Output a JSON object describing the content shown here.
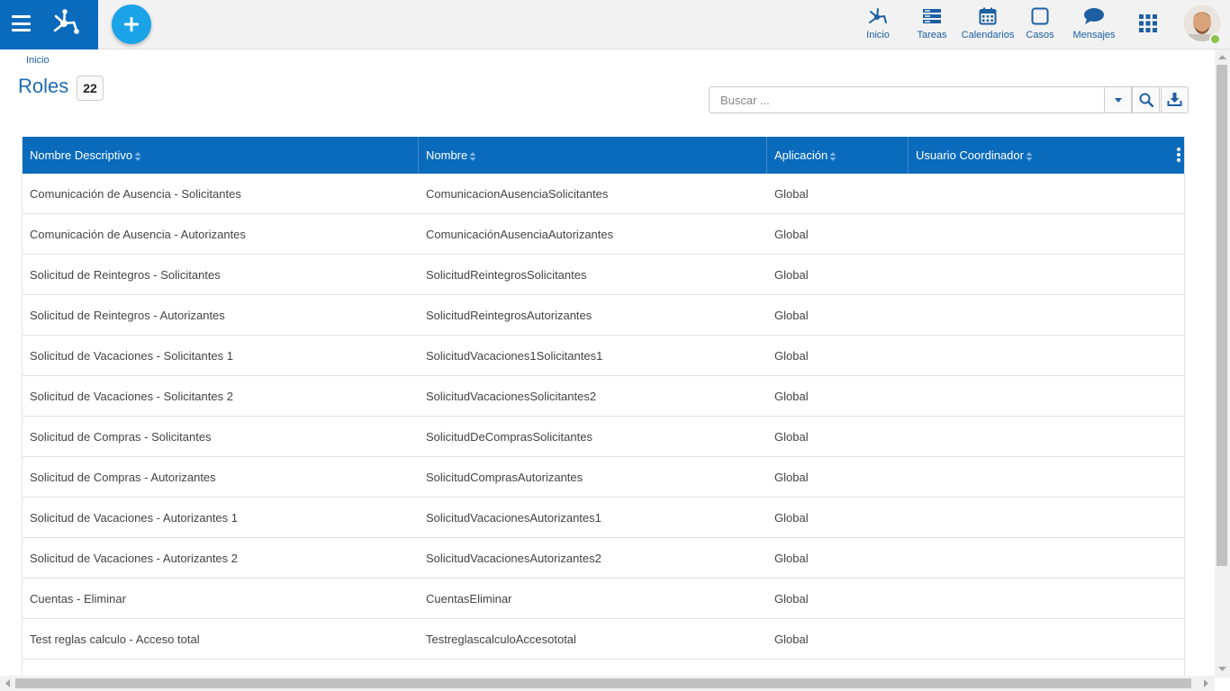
{
  "header": {
    "nav": [
      {
        "id": "inicio",
        "label": "Inicio",
        "icon": "process-icon"
      },
      {
        "id": "tareas",
        "label": "Tareas",
        "icon": "tasks-icon"
      },
      {
        "id": "calendarios",
        "label": "Calendarios",
        "icon": "calendar-icon"
      },
      {
        "id": "casos",
        "label": "Casos",
        "icon": "cases-icon"
      },
      {
        "id": "mensajes",
        "label": "Mensajes",
        "icon": "chat-icon"
      }
    ],
    "brand_color": "#0a6bbd",
    "accent_color": "#1ba3e8"
  },
  "breadcrumb": "Inicio",
  "page": {
    "title": "Roles",
    "count": "22"
  },
  "search": {
    "placeholder": "Buscar ..."
  },
  "table": {
    "columns": [
      "Nombre Descriptivo",
      "Nombre",
      "Aplicación",
      "Usuario Coordinador"
    ],
    "rows": [
      [
        "Comunicación de Ausencia - Solicitantes",
        "ComunicacionAusenciaSolicitantes",
        "Global",
        ""
      ],
      [
        "Comunicación de Ausencia - Autorizantes",
        "ComunicaciónAusenciaAutorizantes",
        "Global",
        ""
      ],
      [
        "Solicitud de Reintegros - Solicitantes",
        "SolicitudReintegrosSolicitantes",
        "Global",
        ""
      ],
      [
        "Solicitud de Reintegros - Autorizantes",
        "SolicitudReintegrosAutorizantes",
        "Global",
        ""
      ],
      [
        "Solicitud de Vacaciones - Solicitantes 1",
        "SolicitudVacaciones1Solicitantes1",
        "Global",
        ""
      ],
      [
        "Solicitud de Vacaciones - Solicitantes 2",
        "SolicitudVacacionesSolicitantes2",
        "Global",
        ""
      ],
      [
        "Solicitud de Compras - Solicitantes",
        "SolicitudDeComprasSolicitantes",
        "Global",
        ""
      ],
      [
        "Solicitud de Compras - Autorizantes",
        "SolicitudComprasAutorizantes",
        "Global",
        ""
      ],
      [
        "Solicitud de Vacaciones - Autorizantes 1",
        "SolicitudVacacionesAutorizantes1",
        "Global",
        ""
      ],
      [
        "Solicitud de Vacaciones - Autorizantes 2",
        "SolicitudVacacionesAutorizantes2",
        "Global",
        ""
      ],
      [
        "Cuentas - Eliminar",
        "CuentasEliminar",
        "Global",
        ""
      ],
      [
        "Test reglas calculo - Acceso total",
        "TestreglascalculoAccesototal",
        "Global",
        ""
      ]
    ]
  }
}
